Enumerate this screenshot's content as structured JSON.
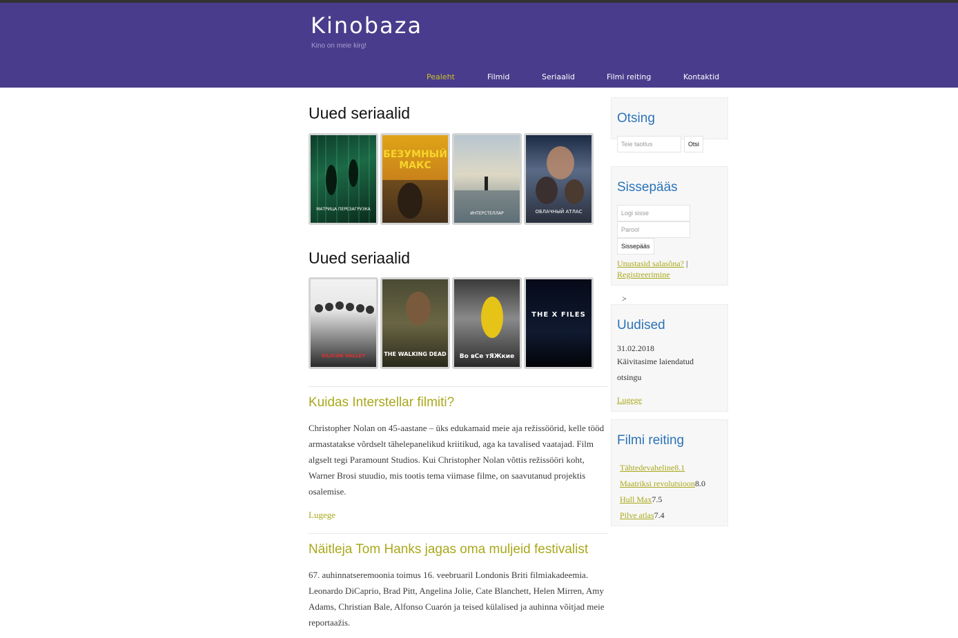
{
  "site": {
    "title": "Kinobaza",
    "tagline": "Kino on meie kirg!"
  },
  "nav": {
    "items": [
      {
        "label": "Pealeht",
        "active": true
      },
      {
        "label": "Filmid",
        "active": false
      },
      {
        "label": "Seriaalid",
        "active": false
      },
      {
        "label": "Filmi reiting",
        "active": false
      },
      {
        "label": "Kontaktid",
        "active": false
      }
    ]
  },
  "sections": [
    {
      "title": "Uued seriaalid",
      "posters": [
        {
          "caption": "МАТРИЦА ПЕРЕЗАГРУЗКА"
        },
        {
          "caption": "БЕЗУМНЫЙ МАКС"
        },
        {
          "caption": "ИНТЕРСТЕЛЛАР"
        },
        {
          "caption": "ОБЛАЧНЫЙ АТЛАС"
        }
      ]
    },
    {
      "title": "Uued seriaalid",
      "posters": [
        {
          "caption": "SILICON VALLEY"
        },
        {
          "caption": "THE WALKING DEAD"
        },
        {
          "caption": "Во вСе тЯЖкие"
        },
        {
          "caption": "THE X FILES"
        }
      ]
    }
  ],
  "articles": [
    {
      "title": "Kuidas Interstellar filmiti?",
      "body": "Christopher Nolan on 45-aastane – üks edukamaid meie aja režissöörid, kelle tööd armastatakse võrdselt tähelepanelikud kriitikud, aga ka tavalised vaatajad. Film algselt tegi Paramount Studios. Kui Christopher Nolan võttis režissööri koht, Warner Brosi stuudio, mis tootis tema viimase filme, on saavutanud projektis osalemise.",
      "read_more": "Lugege"
    },
    {
      "title": "Näitleja Tom Hanks jagas oma muljeid festivalist",
      "body": "67. auhinnatseremoonia toimus 16. veebruaril Londonis Briti filmiakadeemia. Leonardo DiCaprio, Brad Pitt, Angelina Jolie, Cate Blanchett, Helen Mirren, Amy Adams, Christian Bale, Alfonso Cuarón ja teised külalised ja auhinna võitjad meie reportaažis."
    }
  ],
  "sidebar": {
    "search": {
      "title": "Otsing",
      "placeholder": "Teie taotlus",
      "button": "Otsi"
    },
    "login": {
      "title": "Sissepääs",
      "login_placeholder": "Logi sisse",
      "password_placeholder": "Parool",
      "button": "Sissepääs",
      "forgot": "Unustasid salasõna?",
      "separator": "|",
      "register": "Registreerimine"
    },
    "stray_text": ">",
    "news": {
      "title": "Uudised",
      "date": "31.02.2018",
      "line1": "Käivitasime laiendatud",
      "line2": "otsingu",
      "read_more": "Lugege"
    },
    "ratings": {
      "title": "Filmi reiting",
      "items": [
        {
          "name": "Tähtedevaheline",
          "score": "8.1",
          "score_in_link": true
        },
        {
          "name": "Maatriksi revolutsioon",
          "score": "8.0",
          "score_in_link": false
        },
        {
          "name": "Hull Max",
          "score": "7.5",
          "score_in_link": false
        },
        {
          "name": "Pilve atlas",
          "score": "7.4",
          "score_in_link": false
        }
      ]
    }
  },
  "colors": {
    "header_bg": "#4a3c8c",
    "nav_active": "#c9c12a",
    "accent_olive": "#a9a81c",
    "widget_title_blue": "#2c73b8"
  }
}
